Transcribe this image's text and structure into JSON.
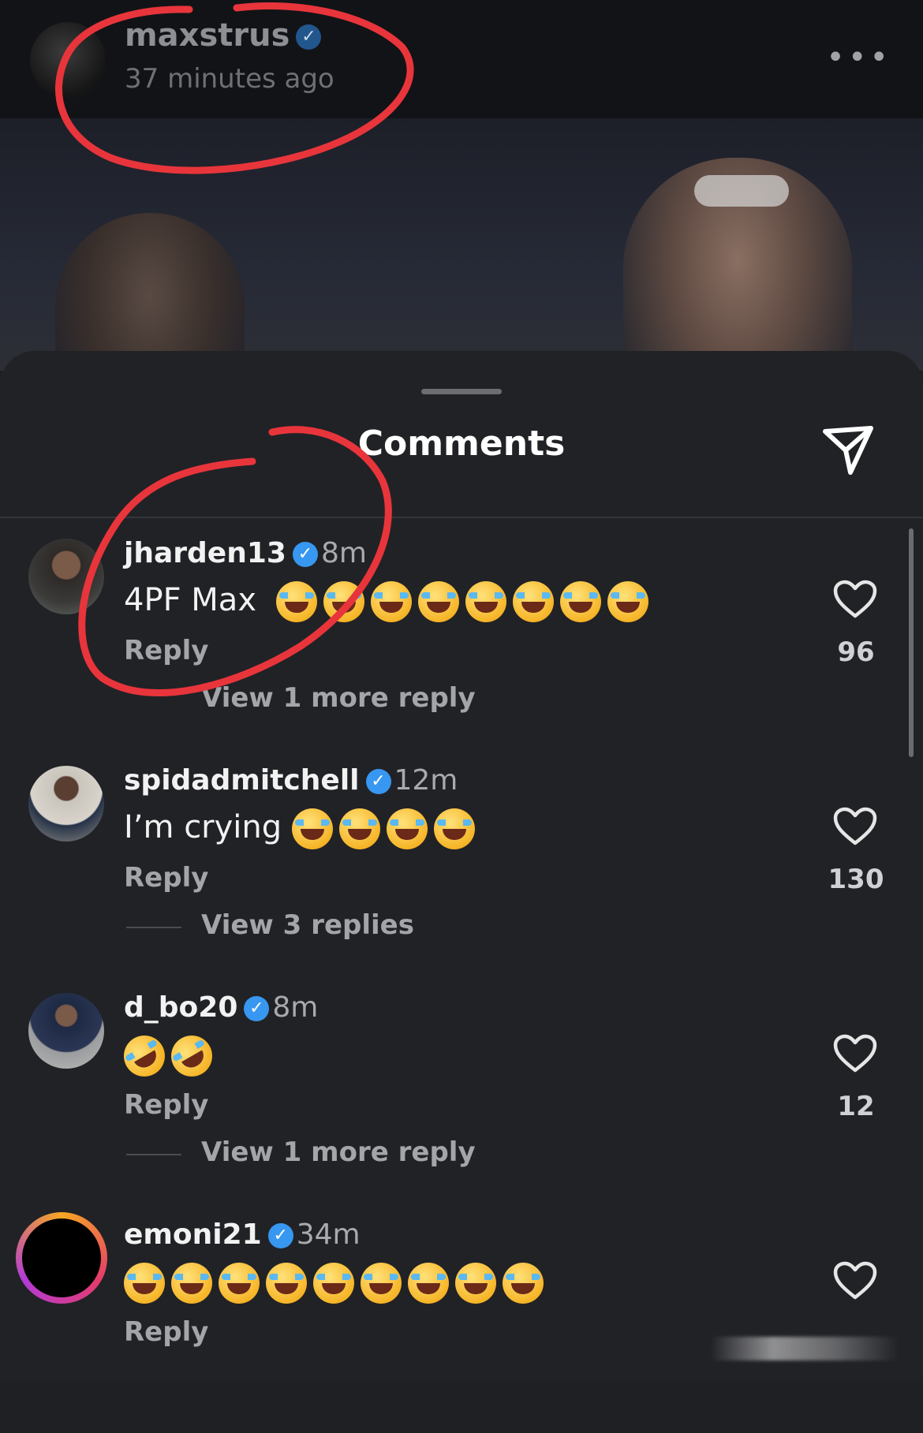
{
  "post": {
    "username": "maxstrus",
    "time": "37 minutes ago",
    "more_icon": "…"
  },
  "sheet": {
    "title": "Comments"
  },
  "comments": [
    {
      "username": "jharden13",
      "time": "8m",
      "text": "4PF Max",
      "emoji": "face-with-tears-of-joy",
      "emoji_count": 8,
      "reply_label": "Reply",
      "likes": "96",
      "view_replies": "View 1 more reply"
    },
    {
      "username": "spidadmitchell",
      "time": "12m",
      "text": "I’m crying",
      "emoji": "face-with-tears-of-joy",
      "emoji_count": 4,
      "reply_label": "Reply",
      "likes": "130",
      "view_replies": "View 3 replies"
    },
    {
      "username": "d_bo20",
      "time": "8m",
      "text": "",
      "emoji": "rolling-on-the-floor-laughing",
      "emoji_count": 2,
      "reply_label": "Reply",
      "likes": "12",
      "view_replies": "View 1 more reply"
    },
    {
      "username": "emoni21",
      "time": "34m",
      "text": "",
      "emoji": "face-with-tears-of-joy",
      "emoji_count": 9,
      "reply_label": "Reply",
      "likes": "",
      "view_replies": ""
    }
  ],
  "colors": {
    "background": "#1f2024",
    "verified": "#3897f0",
    "annotation": "#e8353b"
  }
}
